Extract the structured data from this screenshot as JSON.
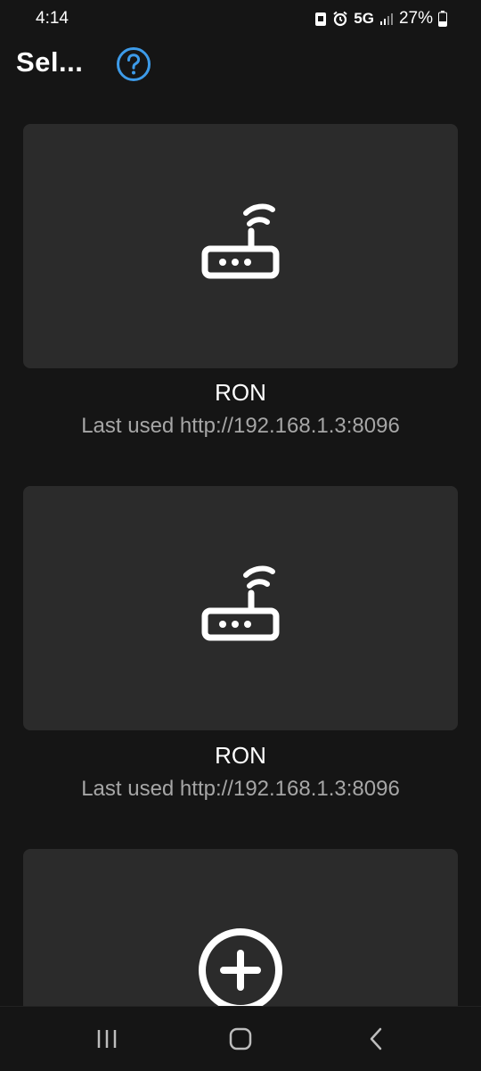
{
  "status_bar": {
    "time": "4:14",
    "network": "5G",
    "battery": "27%"
  },
  "header": {
    "title": "Sel...",
    "help_icon": "question-circle-icon",
    "accent_color": "#3d9be9"
  },
  "servers": [
    {
      "name": "RON",
      "last_used": "Last used http://192.168.1.3:8096",
      "icon": "router-icon"
    },
    {
      "name": "RON",
      "last_used": "Last used http://192.168.1.3:8096",
      "icon": "router-icon"
    }
  ],
  "add_server": {
    "icon": "add-circle-icon"
  },
  "nav_bar": {
    "recents_icon": "recents-icon",
    "home_icon": "home-icon",
    "back_icon": "back-icon"
  }
}
